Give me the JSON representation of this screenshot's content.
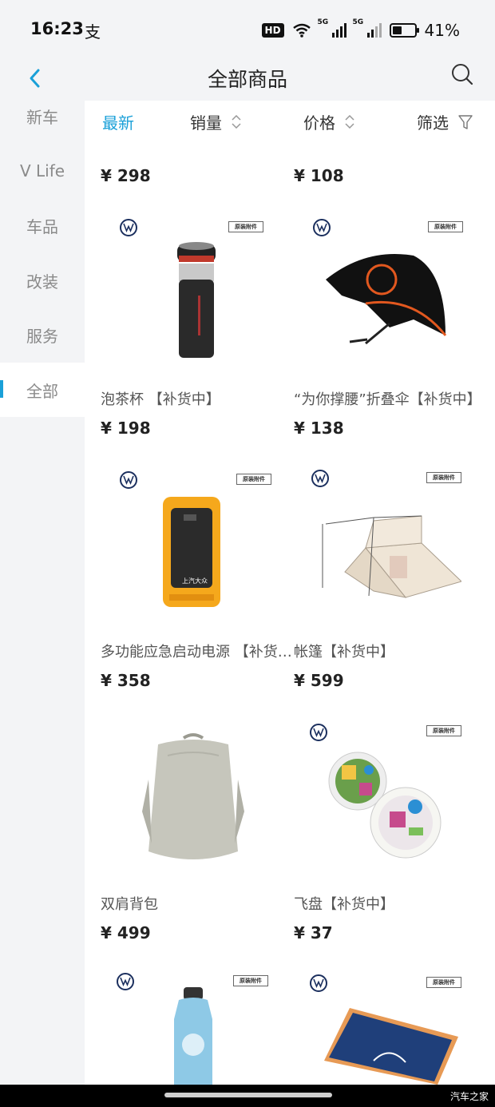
{
  "status_bar": {
    "time": "16:23",
    "app_icon": "支",
    "hd": "HD",
    "net1": "5G",
    "net2": "5G",
    "battery": "41%"
  },
  "header": {
    "title": "全部商品"
  },
  "sidebar": {
    "items": [
      {
        "label": "新车",
        "active": false
      },
      {
        "label": "V Life",
        "active": false
      },
      {
        "label": "车品",
        "active": false
      },
      {
        "label": "改装",
        "active": false
      },
      {
        "label": "服务",
        "active": false
      },
      {
        "label": "全部",
        "active": true
      }
    ]
  },
  "sort": {
    "newest": "最新",
    "sales": "销量",
    "price": "价格",
    "filter": "筛选"
  },
  "top_prices": {
    "left": "¥ 298",
    "right": "¥ 108"
  },
  "products": [
    {
      "name": "泡茶杯 【补货中】",
      "price": "¥ 198",
      "image": "tea-cup-bottle"
    },
    {
      "name": "“为你撑腰”折叠伞【补货中】",
      "price": "¥ 138",
      "image": "folding-umbrella"
    },
    {
      "name": "多功能应急启动电源 【补货中】",
      "price": "¥ 358",
      "image": "jump-starter",
      "device_text": "上汽大众"
    },
    {
      "name": "帐篷【补货中】",
      "price": "¥ 599",
      "image": "tent"
    },
    {
      "name": "双肩背包",
      "price": "¥ 499",
      "image": "backpack"
    },
    {
      "name": "飞盘【补货中】",
      "price": "¥ 37",
      "image": "frisbee"
    },
    {
      "name": "",
      "price": "",
      "image": "water-bottle"
    },
    {
      "name": "",
      "price": "",
      "image": "towel"
    }
  ],
  "oem_tag": "原装附件",
  "watermark": "汽车之家",
  "colors": {
    "accent": "#1aa0d8",
    "price": "#222222",
    "background": "#f3f4f6"
  }
}
